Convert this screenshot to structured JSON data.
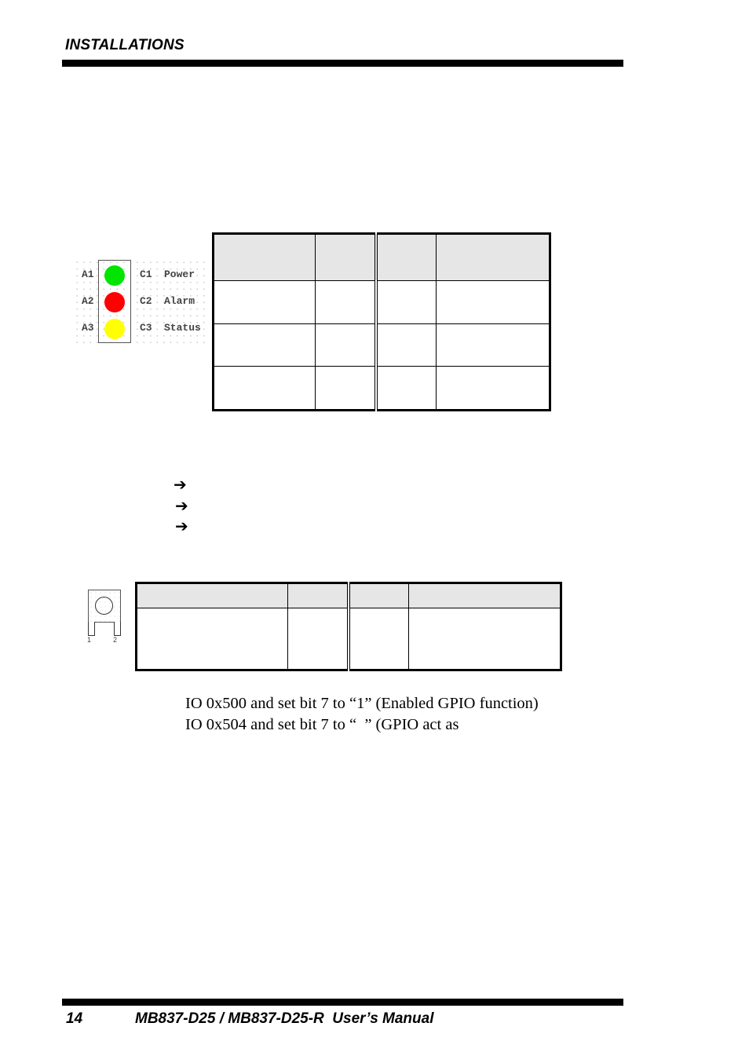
{
  "header": {
    "section_title": "INSTALLATIONS"
  },
  "led_diagram": {
    "pins": [
      {
        "anode": "A1",
        "cathode": "C1",
        "label": "Power",
        "color": "#00e400"
      },
      {
        "anode": "A2",
        "cathode": "C2",
        "label": "Alarm",
        "color": "#ff0000"
      },
      {
        "anode": "A3",
        "cathode": "C3",
        "label": "Status",
        "color": "#ffff00"
      }
    ]
  },
  "led_table": {
    "header": [
      "",
      "",
      "",
      ""
    ],
    "rows": [
      [
        "",
        "",
        "",
        ""
      ],
      [
        "",
        "",
        "",
        ""
      ],
      [
        "",
        "",
        "",
        ""
      ]
    ]
  },
  "arrow_list": {
    "icon": "➔",
    "items": [
      "",
      "",
      ""
    ]
  },
  "buzzer_diagram": {
    "pin_labels": [
      "1",
      "2"
    ]
  },
  "buzzer_table": {
    "header": [
      "",
      "",
      "",
      ""
    ],
    "rows": [
      [
        "",
        "",
        "",
        ""
      ]
    ]
  },
  "body_text": {
    "line1": "IO 0x500 and set bit 7 to “1” (Enabled GPIO function)",
    "line2": "IO 0x504 and set bit 7 to “  ” (GPIO act as"
  },
  "footer": {
    "page_number": "14",
    "manual_title": "MB837-D25 / MB837-D25-R  User’s Manual"
  }
}
